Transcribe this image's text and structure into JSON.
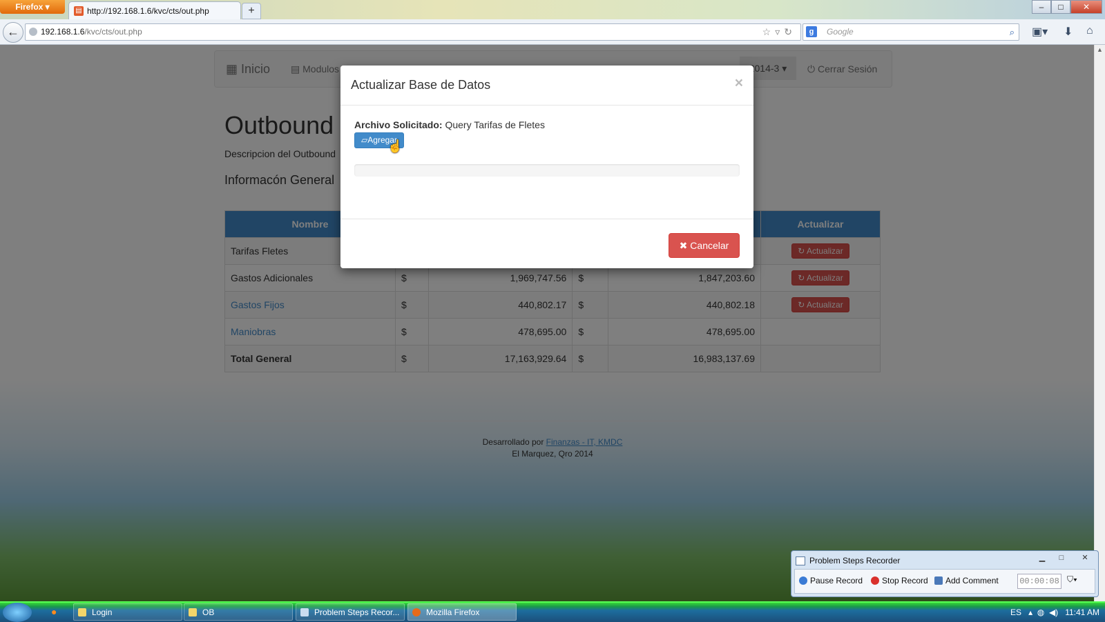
{
  "browser": {
    "menu_label": "Firefox",
    "tab_title": "http://192.168.1.6/kvc/cts/out.php",
    "new_tab": "+",
    "url_host": "192.168.1.6",
    "url_path": "/kvc/cts/out.php",
    "search_placeholder": "Google",
    "window_controls": {
      "minimize": "–",
      "maximize": "□",
      "close": "✕"
    }
  },
  "app_nav": {
    "brand": "Inicio",
    "modulos": "Modulos",
    "periodo": "2014-3",
    "cerrar_sesion": "Cerrar Sesión"
  },
  "page": {
    "title": "Outbound",
    "description": "Descripcion del Outbound",
    "section_title": "Informacón General"
  },
  "table": {
    "headers": [
      "Nombre",
      "",
      "",
      "Actualizar"
    ],
    "rows": [
      {
        "name": "Tarifas Fletes",
        "cur1": "",
        "val1": "",
        "cur2": "",
        "val2": "",
        "action": "Actualizar",
        "link": false
      },
      {
        "name": "Gastos Adicionales",
        "cur1": "$",
        "val1": "1,969,747.56",
        "cur2": "$",
        "val2": "1,847,203.60",
        "action": "Actualizar",
        "link": false
      },
      {
        "name": "Gastos Fijos",
        "cur1": "$",
        "val1": "440,802.17",
        "cur2": "$",
        "val2": "440,802.18",
        "action": "Actualizar",
        "link": true
      },
      {
        "name": "Maniobras",
        "cur1": "$",
        "val1": "478,695.00",
        "cur2": "$",
        "val2": "478,695.00",
        "action": "",
        "link": true
      },
      {
        "name": "Total General",
        "cur1": "$",
        "val1": "17,163,929.64",
        "cur2": "$",
        "val2": "16,983,137.69",
        "action": "",
        "link": false,
        "bold": true
      }
    ]
  },
  "footer": {
    "prefix": "Desarrollado por",
    "link": "Finanzas - IT, KMDC",
    "line2": "El Marquez, Qro 2014"
  },
  "modal": {
    "title": "Actualizar Base de Datos",
    "close": "×",
    "file_label": "Archivo Solicitado:",
    "file_value": "Query Tarifas de Fletes",
    "add_button": "Agregar",
    "progress": 0,
    "cancel_button": "Cancelar"
  },
  "steps_recorder": {
    "title": "Problem Steps Recorder",
    "pause": "Pause Record",
    "stop": "Stop Record",
    "comment": "Add Comment",
    "timer": "00:00:08"
  },
  "taskbar": {
    "items": [
      "Login",
      "OB",
      "Problem Steps Recor...",
      "Mozilla Firefox"
    ],
    "lang": "ES",
    "time": "11:41 AM"
  }
}
